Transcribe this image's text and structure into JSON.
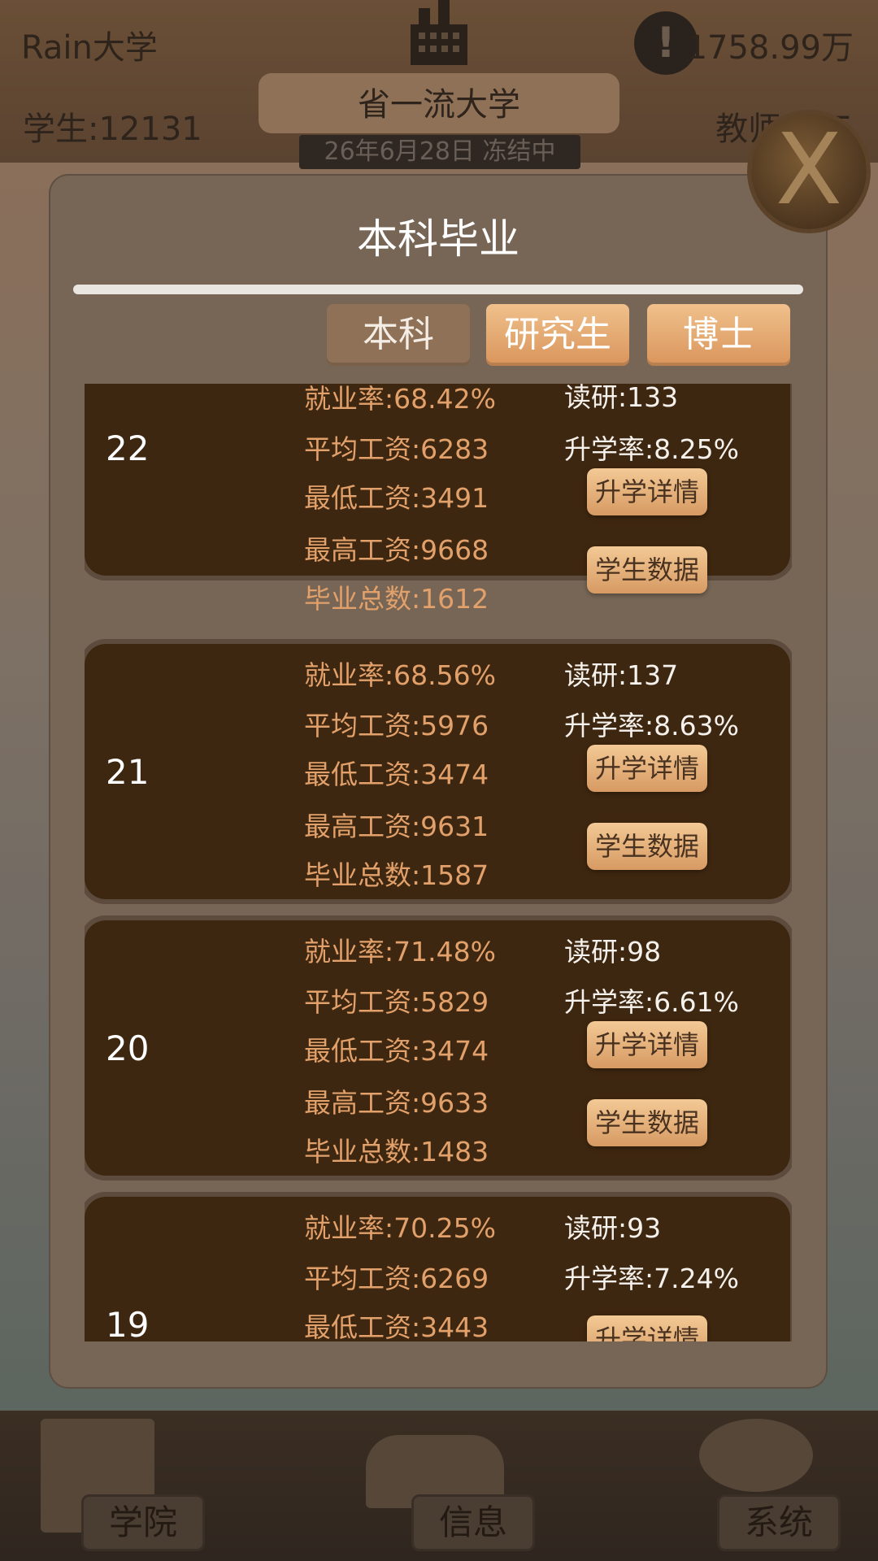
{
  "header": {
    "university_name": "Rain大学",
    "funds": "1758.99万",
    "students": "学生:12131",
    "teachers": "教师:325",
    "rank_title": "省一流大学",
    "date_status": "26年6月28日 冻结中"
  },
  "modal": {
    "title": "本科毕业",
    "close_label": "X",
    "tabs": [
      {
        "label": "本科",
        "active": true
      },
      {
        "label": "研究生",
        "active": false
      },
      {
        "label": "博士",
        "active": false
      }
    ],
    "records": [
      {
        "year": "22",
        "employment_rate": "就业率:68.42%",
        "avg_salary": "平均工资:6283",
        "min_salary": "最低工资:3491",
        "max_salary": "最高工资:9668",
        "total_grads": "毕业总数:1612",
        "grad_school": "读研:133",
        "advance_rate": "升学率:8.25%",
        "detail_btn": "升学详情",
        "data_btn": "学生数据"
      },
      {
        "year": "21",
        "employment_rate": "就业率:68.56%",
        "avg_salary": "平均工资:5976",
        "min_salary": "最低工资:3474",
        "max_salary": "最高工资:9631",
        "total_grads": "毕业总数:1587",
        "grad_school": "读研:137",
        "advance_rate": "升学率:8.63%",
        "detail_btn": "升学详情",
        "data_btn": "学生数据"
      },
      {
        "year": "20",
        "employment_rate": "就业率:71.48%",
        "avg_salary": "平均工资:5829",
        "min_salary": "最低工资:3474",
        "max_salary": "最高工资:9633",
        "total_grads": "毕业总数:1483",
        "grad_school": "读研:98",
        "advance_rate": "升学率:6.61%",
        "detail_btn": "升学详情",
        "data_btn": "学生数据"
      },
      {
        "year": "19",
        "employment_rate": "就业率:70.25%",
        "avg_salary": "平均工资:6269",
        "min_salary": "最低工资:3443",
        "grad_school": "读研:93",
        "advance_rate": "升学率:7.24%",
        "detail_btn": "升学详情"
      }
    ]
  },
  "bottom_nav": {
    "college": "学院",
    "info": "信息",
    "system": "系统"
  },
  "colors": {
    "modal_bg": "#776656",
    "card_bg": "#3e2710",
    "accent_orange": "#e2a06a",
    "button_gradient_top": "#f3c995"
  }
}
